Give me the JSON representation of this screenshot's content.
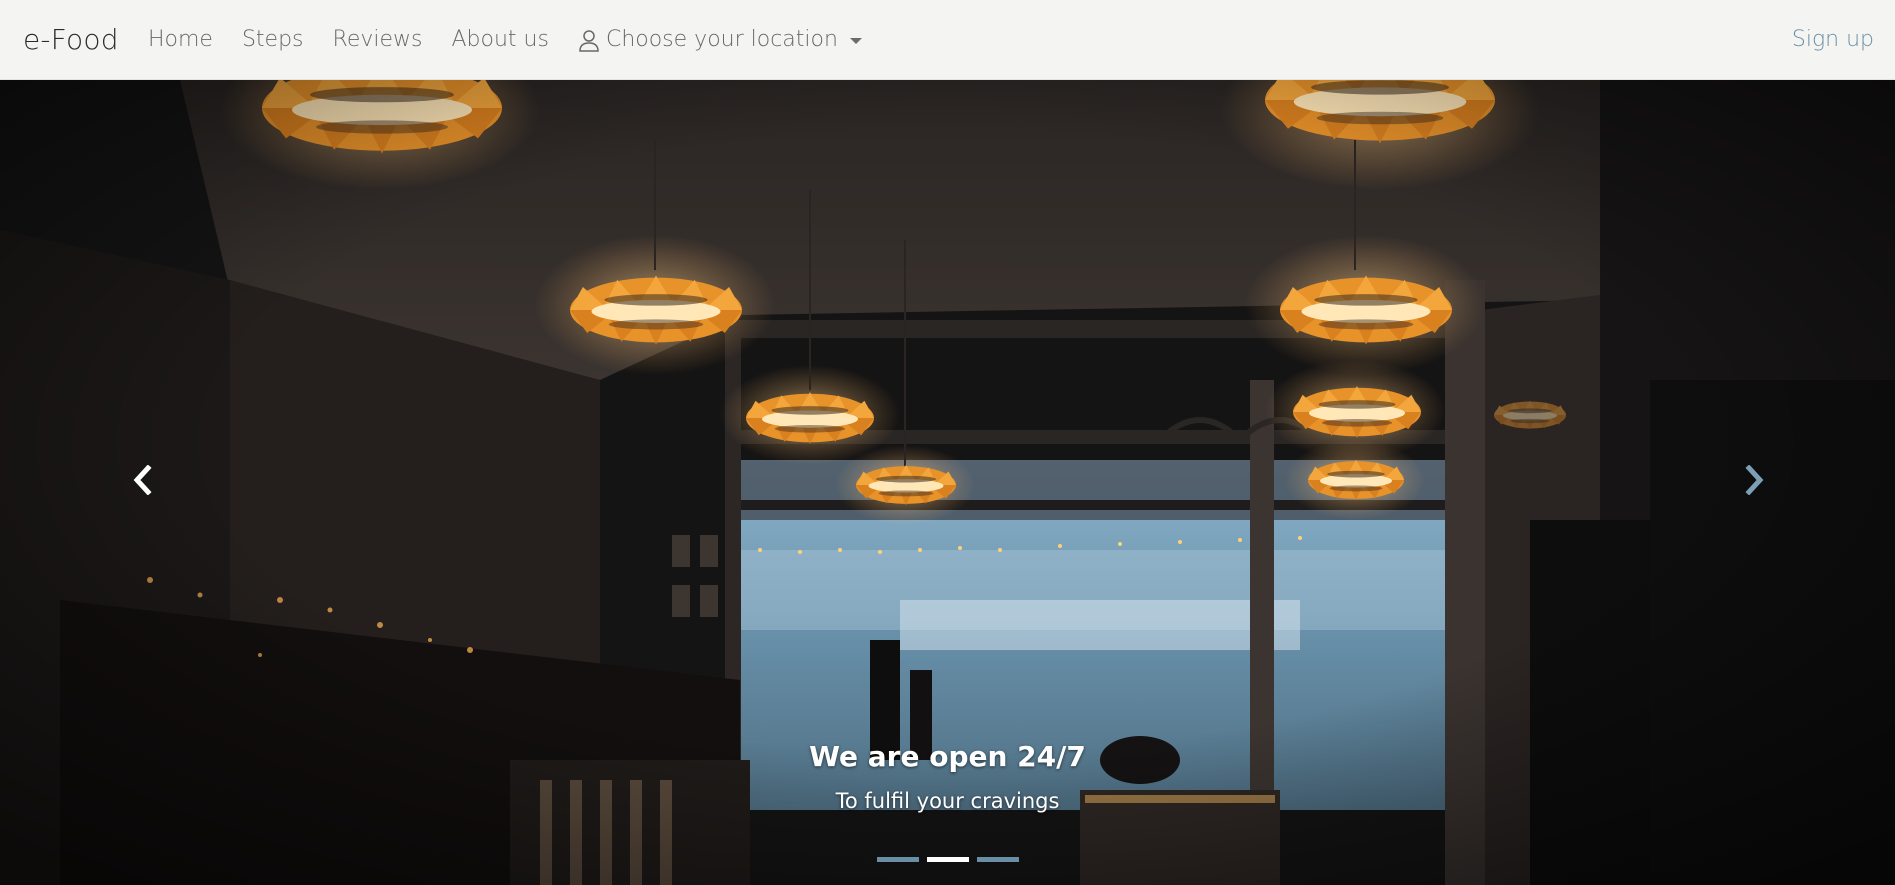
{
  "navbar": {
    "brand": "e-Food",
    "links": [
      "Home",
      "Steps",
      "Reviews",
      "About us"
    ],
    "location_label": "Choose your location",
    "signup_label": "Sign up"
  },
  "carousel": {
    "caption_title": "We are open 24/7",
    "caption_text": "To fulfil your cravings",
    "active_slide": 2,
    "slide_count": 3
  },
  "icons": {
    "location": "person-icon",
    "dropdown": "caret-down-icon",
    "prev": "chevron-left-icon",
    "next": "chevron-right-icon"
  },
  "colors": {
    "navbar_bg": "#f4f4f2",
    "signup": "#6e8fa6",
    "lamp": "#e8922a",
    "window": "#6f98b3"
  }
}
